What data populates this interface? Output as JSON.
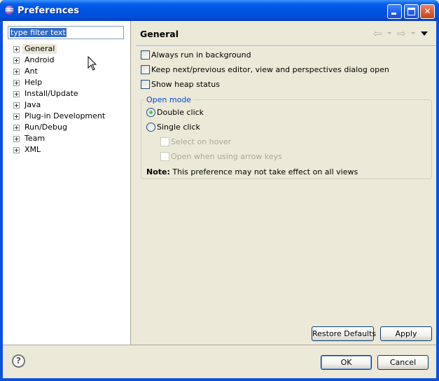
{
  "window": {
    "title": "Preferences",
    "icon": "eclipse-icon",
    "controls": {
      "minimize": "minimize",
      "maximize": "maximize",
      "close": "close"
    }
  },
  "sidebar": {
    "filter_value": "type filter text",
    "items": [
      {
        "label": "General",
        "selected": true
      },
      {
        "label": "Android"
      },
      {
        "label": "Ant"
      },
      {
        "label": "Help"
      },
      {
        "label": "Install/Update"
      },
      {
        "label": "Java"
      },
      {
        "label": "Plug-in Development"
      },
      {
        "label": "Run/Debug"
      },
      {
        "label": "Team"
      },
      {
        "label": "XML"
      }
    ]
  },
  "page": {
    "title": "General",
    "nav_icons": [
      "back-arrow-icon",
      "forward-arrow-icon",
      "view-menu-icon"
    ],
    "options": [
      {
        "label": "Always run in background",
        "checked": false
      },
      {
        "label": "Keep next/previous editor, view and perspectives dialog open",
        "checked": false
      },
      {
        "label": "Show heap status",
        "checked": false
      }
    ],
    "open_mode": {
      "title": "Open mode",
      "double_click": "Double click",
      "single_click": "Single click",
      "selected": "Double click",
      "select_on_hover": "Select on hover",
      "open_arrow_keys": "Open when using arrow keys",
      "note_label": "Note:",
      "note_text": "This preference may not take effect on all views"
    },
    "restore_defaults": "Restore Defaults",
    "apply": "Apply"
  },
  "footer": {
    "help": "?",
    "ok": "OK",
    "cancel": "Cancel"
  },
  "colors": {
    "titlebar": "#0054e3",
    "dialog_bg": "#ece9d8",
    "group_title": "#0046d5",
    "selection": "#316ac5"
  }
}
